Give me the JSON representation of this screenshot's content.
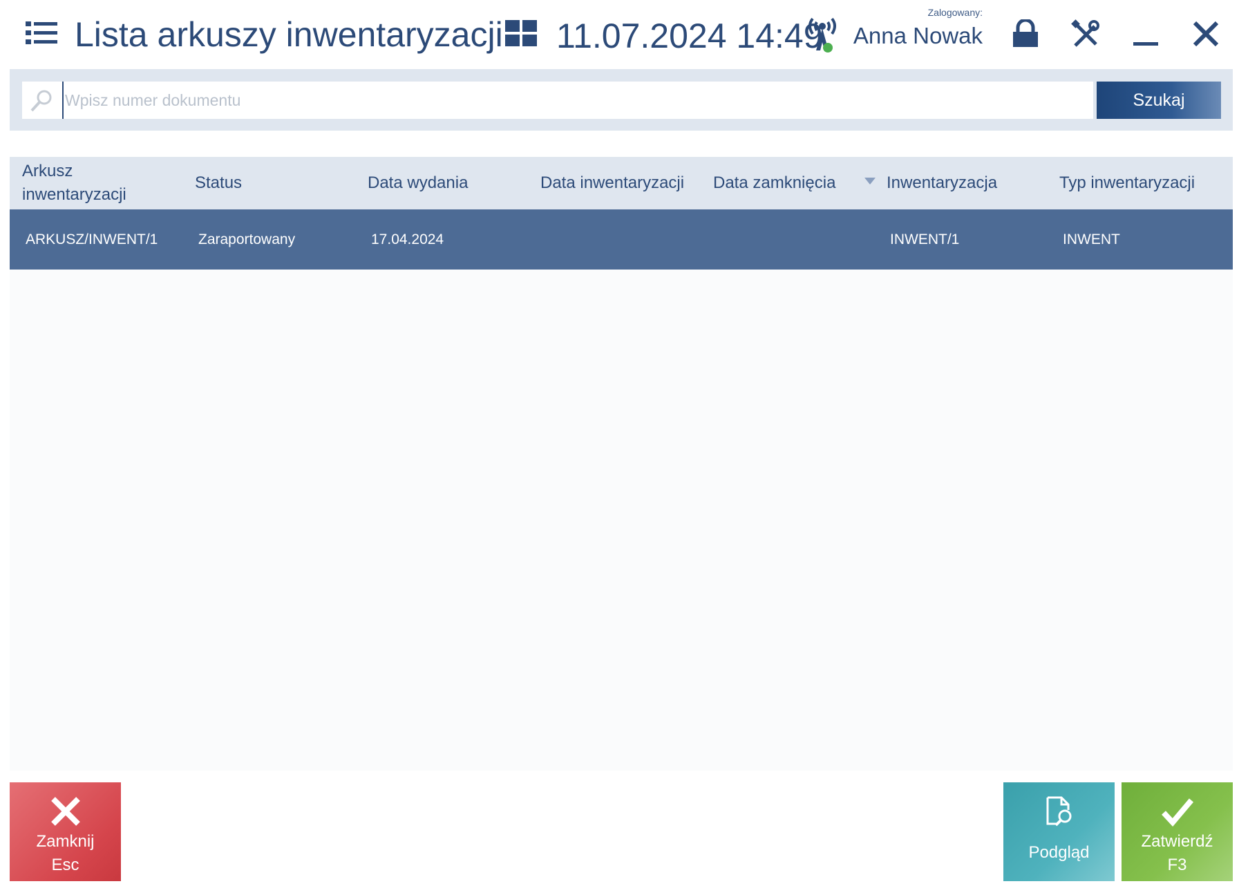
{
  "header": {
    "title": "Lista arkuszy inwentaryzacji",
    "datetime": "11.07.2024 14:49",
    "logged_label": "Zalogowany:",
    "user_name": "Anna Nowak",
    "icons": [
      "menu-icon",
      "tiles-icon",
      "connection-status-icon",
      "lock-icon",
      "tools-icon",
      "minimize-icon",
      "close-icon"
    ],
    "connection_status_color": "#4caf50"
  },
  "search": {
    "placeholder": "Wpisz numer dokumentu",
    "value": "",
    "button_label": "Szukaj"
  },
  "table": {
    "columns": [
      "Arkusz\ninwentaryzacji",
      "Status",
      "Data wydania",
      "Data inwentaryzacji",
      "Data zamknięcia",
      "Inwentaryzacja",
      "Typ inwentaryzacji"
    ],
    "sorted_column_index": 4,
    "rows": [
      {
        "arkusz": "ARKUSZ/INWENT/1",
        "status": "Zaraportowany",
        "data_wydania": "17.04.2024",
        "data_inwentaryzacji": "",
        "data_zamkniecia": "",
        "inwentaryzacja": "INWENT/1",
        "typ": "INWENT",
        "selected": true
      }
    ]
  },
  "buttons": {
    "close": {
      "label": "Zamknij",
      "shortcut": "Esc"
    },
    "preview": {
      "label": "Podgląd"
    },
    "confirm": {
      "label": "Zatwierdź",
      "shortcut": "F3"
    }
  },
  "colors": {
    "accent": "#2c4a78",
    "selected_row": "#4d6b95",
    "header_bg": "#dfe6ef",
    "close_button": "#d5454c",
    "preview_button": "#4fb2bd",
    "confirm_button": "#85c04c"
  }
}
